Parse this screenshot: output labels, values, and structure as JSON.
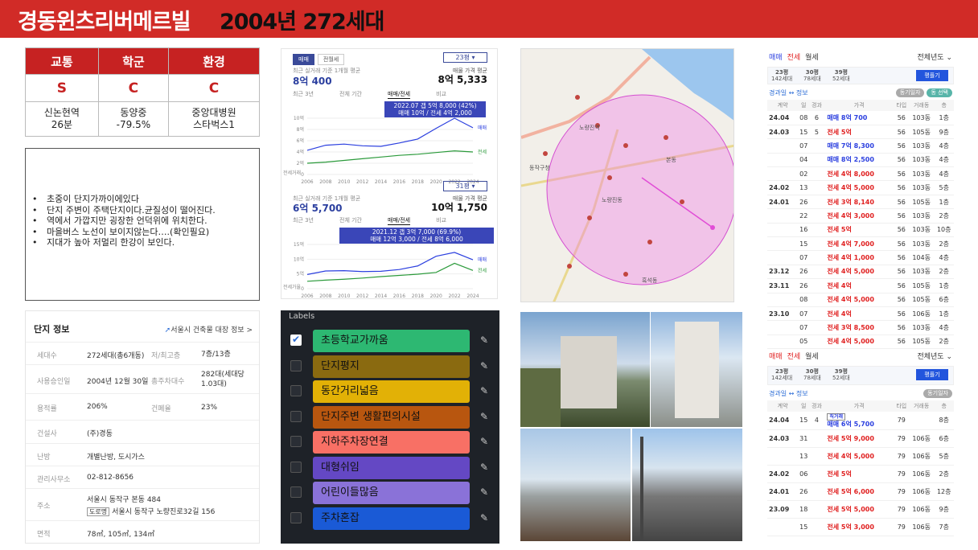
{
  "header": {
    "title": "경동윈츠리버메르빌",
    "subtitle": "2004년 272세대"
  },
  "score": {
    "headers": [
      "교통",
      "학군",
      "환경"
    ],
    "grades": [
      "S",
      "C",
      "C"
    ],
    "notes": [
      [
        "신논현역",
        "26분"
      ],
      [
        "동양중",
        "-79.5%"
      ],
      [
        "중앙대병원",
        "스타벅스1"
      ]
    ]
  },
  "notes": [
    "초중이 단지가까이에있다",
    "단지 주변이 주택단지이다.균질성이  떨어진다.",
    "역에서 가깝지만 굉장한 언덕위에 위치한다.",
    "마을버스 노선이 보이지않는다….(확인필요)",
    "지대가 높아 저멀리 한강이 보인다."
  ],
  "info": {
    "title": "단지 정보",
    "link": "서울시 건축물 대장 정보 >",
    "rows": [
      {
        "k": "세대수",
        "v": "272세대(총6개동)",
        "k2": "저/최고층",
        "v2": "7층/13층"
      },
      {
        "k": "사용승인일",
        "v": "2004년 12월 30일",
        "k2": "총주차대수",
        "v2": "282대(세대당 1.03대)"
      },
      {
        "k": "용적률",
        "v": "206%",
        "k2": "건폐율",
        "v2": "23%"
      },
      {
        "k": "건설사",
        "v": "(주)경동",
        "k2": "",
        "v2": ""
      },
      {
        "k": "난방",
        "v": "개별난방, 도시가스",
        "k2": "",
        "v2": ""
      },
      {
        "k": "관리사무소",
        "v": "02-812-8656",
        "k2": "",
        "v2": ""
      },
      {
        "k": "주소",
        "v": "서울시 동작구 본동 484",
        "k2": "",
        "v2": ""
      },
      {
        "k": "면적",
        "v": "78㎡, 105㎡, 134㎡",
        "k2": "",
        "v2": ""
      }
    ],
    "road_tag": "도로명",
    "road": "서울시 동작구 노량진로32길 156"
  },
  "chart1": {
    "tabs": [
      "매매",
      "전월세"
    ],
    "size": "23평",
    "label_l": "최근 실거래 기준 1개월 평균",
    "val_l": "8억 400",
    "label_r": "매물 가격 평균",
    "val_r": "8억 5,333",
    "rtabs": [
      "최근 3년",
      "전체 기간",
      "매매/전세",
      "비교"
    ],
    "callout": [
      "2022.07  갭 5억 8,000 (42%)",
      "매매 10억 / 전세 4억 2,000"
    ],
    "legend": [
      "매매",
      "전세"
    ],
    "yticks": [
      "10억",
      "8억",
      "6억",
      "4억",
      "2억",
      "0"
    ],
    "vol": "전세거래",
    "years": [
      "2006",
      "2008",
      "2010",
      "2012",
      "2014",
      "2016",
      "2018",
      "2020",
      "2022",
      "2024"
    ]
  },
  "chart2": {
    "size": "31평",
    "label_l": "최근 실거래 기준 1개월 평균",
    "val_l": "6억 5,700",
    "label_r": "매물 가격 평균",
    "val_r": "10억 1,750",
    "rtabs": [
      "최근 3년",
      "전체 기간",
      "매매/전세",
      "비교"
    ],
    "callout": [
      "2021.12  갭 3억 7,000 (69.9%)",
      "매매 12억 3,000 / 전세 8억 6,000"
    ],
    "legend": [
      "매매",
      "전세"
    ],
    "yticks": [
      "15억",
      "10억",
      "5억",
      "0"
    ],
    "vol": "전세가율",
    "years": [
      "2006",
      "2008",
      "2010",
      "2012",
      "2014",
      "2016",
      "2018",
      "2020",
      "2022",
      "2024"
    ]
  },
  "chart_data": [
    {
      "type": "line",
      "x": [
        "2006",
        "2008",
        "2010",
        "2012",
        "2014",
        "2016",
        "2018",
        "2020",
        "2022",
        "2024"
      ],
      "series": [
        {
          "name": "매매",
          "values": [
            4.3,
            5.2,
            5.4,
            5.1,
            5.0,
            5.6,
            6.3,
            8.2,
            10,
            8.3
          ]
        },
        {
          "name": "전세",
          "values": [
            2.0,
            2.2,
            2.5,
            2.8,
            3.1,
            3.4,
            3.6,
            3.9,
            4.2,
            4.0
          ]
        }
      ],
      "ylim": [
        0,
        10
      ]
    },
    {
      "type": "line",
      "x": [
        "2006",
        "2008",
        "2010",
        "2012",
        "2014",
        "2016",
        "2018",
        "2020",
        "2022",
        "2024"
      ],
      "series": [
        {
          "name": "매매",
          "values": [
            4.8,
            6.0,
            6.1,
            5.8,
            5.9,
            6.5,
            7.7,
            11,
            12.3,
            9.8
          ]
        },
        {
          "name": "전세",
          "values": [
            2.5,
            2.9,
            3.2,
            3.6,
            4.1,
            4.5,
            4.9,
            5.5,
            8.6,
            6.2
          ]
        }
      ],
      "ylim": [
        0,
        15
      ]
    }
  ],
  "map": {
    "labels": [
      "노량진역",
      "동작구청",
      "노량진동",
      "흑석동",
      "본동"
    ]
  },
  "labels": {
    "title": "Labels",
    "items": [
      {
        "text": "초등학교가까움",
        "color": "#2db872",
        "checked": true
      },
      {
        "text": "단지평지",
        "color": "#8a6a10",
        "checked": false
      },
      {
        "text": "동간거리넓음",
        "color": "#e2b106",
        "checked": false
      },
      {
        "text": "단지주변 생활편의시설",
        "color": "#b8560f",
        "checked": false
      },
      {
        "text": "지하주차장연결",
        "color": "#f87065",
        "checked": false
      },
      {
        "text": "대형쉬임",
        "color": "#6448c4",
        "checked": false
      },
      {
        "text": "어린이들많음",
        "color": "#8a72d8",
        "checked": false
      },
      {
        "text": "주차혼잡",
        "color": "#1a5ad6",
        "checked": false
      }
    ]
  },
  "tx1": {
    "tabs": [
      "매매",
      "전세",
      "월세"
    ],
    "filter": "전체년도",
    "sizes": [
      [
        "23평",
        "142세대"
      ],
      [
        "30평",
        "78세대"
      ],
      [
        "39평",
        "52세대"
      ]
    ],
    "btn": "평플기",
    "gh": "경과일 ↔ 정보",
    "chips": [
      "동기일자",
      "동 선택"
    ],
    "cols": [
      "계약",
      "일",
      "경과",
      "가격",
      "타입",
      "거래동",
      "층"
    ],
    "rows": [
      [
        "24.04",
        "08",
        "6",
        "매매 8억 700",
        "56",
        "103동",
        "1층"
      ],
      [
        "24.03",
        "15",
        "5",
        "전세 5억",
        "56",
        "105동",
        "9층"
      ],
      [
        "",
        "07",
        "",
        "매매 7억 8,300",
        "56",
        "103동",
        "4층"
      ],
      [
        "",
        "04",
        "",
        "매매 8억 2,500",
        "56",
        "103동",
        "4층"
      ],
      [
        "",
        "02",
        "",
        "전세 4억 8,000",
        "56",
        "103동",
        "4층"
      ],
      [
        "24.02",
        "13",
        "",
        "전세 4억 5,000",
        "56",
        "103동",
        "5층"
      ],
      [
        "24.01",
        "26",
        "",
        "전세 3억 8,140",
        "56",
        "105동",
        "1층"
      ],
      [
        "",
        "22",
        "",
        "전세 4억 3,000",
        "56",
        "103동",
        "2층"
      ],
      [
        "",
        "16",
        "",
        "전세 5억",
        "56",
        "103동",
        "10층"
      ],
      [
        "",
        "15",
        "",
        "전세 4억 7,000",
        "56",
        "103동",
        "2층"
      ],
      [
        "",
        "07",
        "",
        "전세 4억 1,000",
        "56",
        "104동",
        "4층"
      ],
      [
        "23.12",
        "26",
        "",
        "전세 4억 5,000",
        "56",
        "103동",
        "2층"
      ],
      [
        "23.11",
        "26",
        "",
        "전세 4억",
        "56",
        "105동",
        "1층"
      ],
      [
        "",
        "08",
        "",
        "전세 4억 5,000",
        "56",
        "105동",
        "6층"
      ],
      [
        "23.10",
        "07",
        "",
        "전세 4억",
        "56",
        "106동",
        "1층"
      ],
      [
        "",
        "07",
        "",
        "전세 3억 8,500",
        "56",
        "103동",
        "4층"
      ],
      [
        "",
        "05",
        "",
        "전세 4억 5,000",
        "56",
        "105동",
        "2층"
      ]
    ]
  },
  "tx2": {
    "tabs": [
      "매매",
      "전세",
      "월세"
    ],
    "filter": "전체년도",
    "sizes": [
      [
        "23평",
        "142세대"
      ],
      [
        "30평",
        "78세대"
      ],
      [
        "39평",
        "52세대"
      ]
    ],
    "btn": "평플기",
    "gh": "경과일 ↔ 정보",
    "chips": [
      "동기일자"
    ],
    "cols": [
      "계약",
      "일",
      "경과",
      "가격",
      "타입",
      "거래동",
      "층"
    ],
    "badge": "직거래",
    "rows": [
      [
        "24.04",
        "15",
        "4",
        "매매 6억 5,700",
        "79",
        "",
        "8층"
      ],
      [
        "24.03",
        "31",
        "",
        "전세 5억 9,000",
        "79",
        "106동",
        "6층"
      ],
      [
        "",
        "13",
        "",
        "전세 4억 5,000",
        "79",
        "106동",
        "5층"
      ],
      [
        "24.02",
        "06",
        "",
        "전세 5억",
        "79",
        "106동",
        "2층"
      ],
      [
        "24.01",
        "26",
        "",
        "전세 5억 6,000",
        "79",
        "106동",
        "12층"
      ],
      [
        "23.09",
        "18",
        "",
        "전세 5억 5,000",
        "79",
        "106동",
        "9층"
      ],
      [
        "",
        "15",
        "",
        "전세 5억 3,000",
        "79",
        "106동",
        "7층"
      ]
    ]
  }
}
